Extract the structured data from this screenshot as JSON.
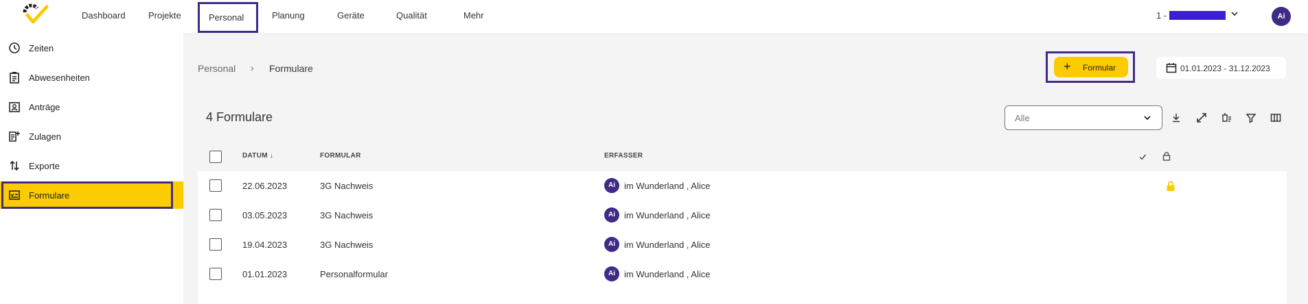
{
  "topnav": {
    "items": [
      "Dashboard",
      "Projekte",
      "Personal",
      "Planung",
      "Geräte",
      "Qualität",
      "Mehr"
    ],
    "active": "Personal",
    "account_prefix": "1 -",
    "avatar_initials": "Ai"
  },
  "sidebar": {
    "items": [
      {
        "label": "Zeiten",
        "icon": "clock-icon"
      },
      {
        "label": "Abwesenheiten",
        "icon": "clipboard-icon"
      },
      {
        "label": "Anträge",
        "icon": "badge-icon"
      },
      {
        "label": "Zulagen",
        "icon": "add-list-icon"
      },
      {
        "label": "Exporte",
        "icon": "swap-vertical-icon"
      },
      {
        "label": "Formulare",
        "icon": "form-icon"
      }
    ],
    "active": "Formulare"
  },
  "breadcrumb": {
    "root": "Personal",
    "separator": "›",
    "current": "Formulare"
  },
  "actions": {
    "add_label": "Formular",
    "date_range": "01.01.2023 - 31.12.2023"
  },
  "list": {
    "count_title": "4 Formulare",
    "filter_value": "Alle",
    "columns": {
      "date": "DATUM",
      "form": "FORMULAR",
      "author": "ERFASSER"
    },
    "rows": [
      {
        "date": "22.06.2023",
        "form": "3G Nachweis",
        "author_initials": "Ai",
        "author": "im Wunderland , Alice",
        "locked": true
      },
      {
        "date": "03.05.2023",
        "form": "3G Nachweis",
        "author_initials": "Ai",
        "author": "im Wunderland , Alice",
        "locked": false
      },
      {
        "date": "19.04.2023",
        "form": "3G Nachweis",
        "author_initials": "Ai",
        "author": "im Wunderland , Alice",
        "locked": false
      },
      {
        "date": "01.01.2023",
        "form": "Personalformular",
        "author_initials": "Ai",
        "author": "im Wunderland , Alice",
        "locked": false
      }
    ]
  },
  "colors": {
    "accent": "#fccb00",
    "brand": "#3f2a86"
  }
}
